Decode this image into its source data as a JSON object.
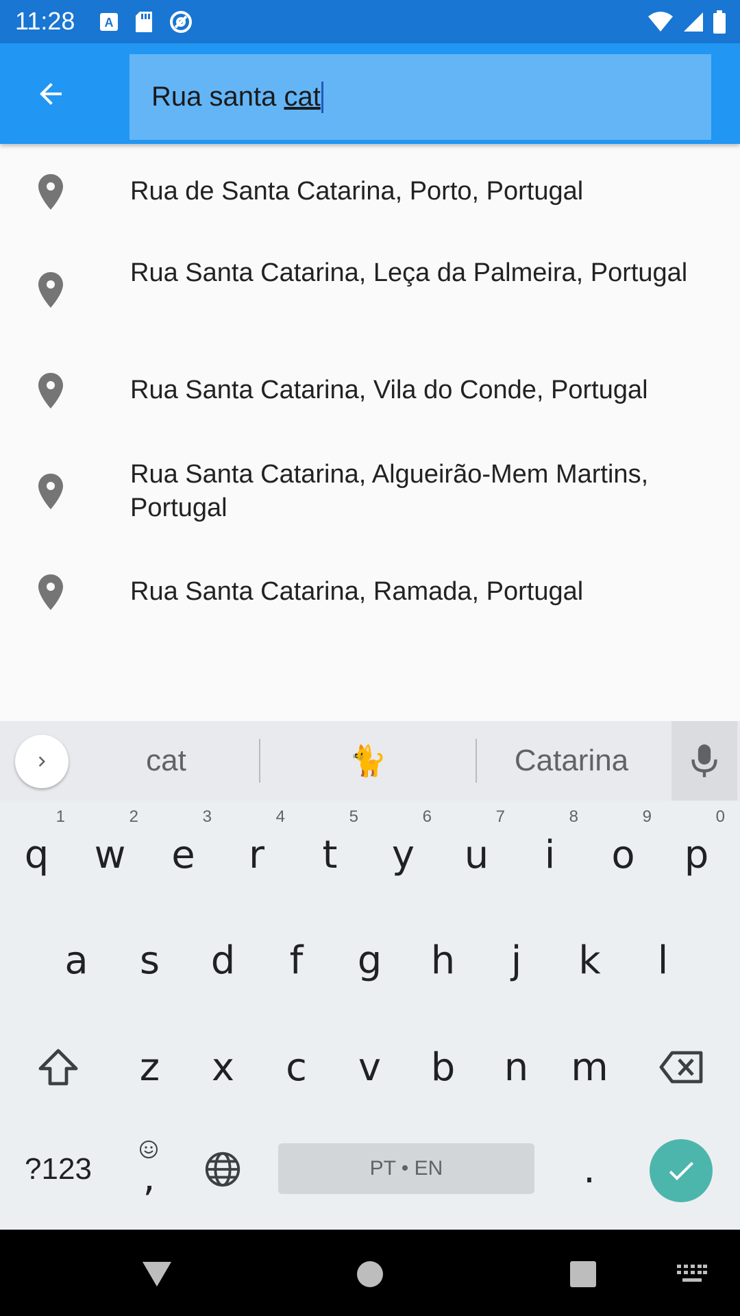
{
  "status_bar": {
    "time": "11:28",
    "left_icons": [
      "text-a-icon",
      "sd-card-icon",
      "at-sync-icon"
    ],
    "right_icons": [
      "wifi-icon",
      "signal-icon",
      "battery-icon"
    ]
  },
  "app_bar": {
    "back_icon": "arrow-back-icon",
    "search": {
      "value_plain": "Rua santa ",
      "value_composing": "cat"
    }
  },
  "results": [
    {
      "label": "Rua de Santa Catarina, Porto, Portugal",
      "icon": "place-pin-icon"
    },
    {
      "label": "Rua Santa Catarina, Leça da Palmeira, Portugal",
      "icon": "place-pin-icon"
    },
    {
      "label": "Rua Santa Catarina, Vila do Conde, Portugal",
      "icon": "place-pin-icon"
    },
    {
      "label": "Rua Santa Catarina, Algueirão-Mem Martins, Portugal",
      "icon": "place-pin-icon"
    },
    {
      "label": "Rua Santa Catarina, Ramada, Portugal",
      "icon": "place-pin-icon"
    }
  ],
  "keyboard": {
    "suggestions": [
      "cat",
      "🐈",
      "Catarina"
    ],
    "row1": [
      {
        "key": "q",
        "hint": "1"
      },
      {
        "key": "w",
        "hint": "2"
      },
      {
        "key": "e",
        "hint": "3"
      },
      {
        "key": "r",
        "hint": "4"
      },
      {
        "key": "t",
        "hint": "5"
      },
      {
        "key": "y",
        "hint": "6"
      },
      {
        "key": "u",
        "hint": "7"
      },
      {
        "key": "i",
        "hint": "8"
      },
      {
        "key": "o",
        "hint": "9"
      },
      {
        "key": "p",
        "hint": "0"
      }
    ],
    "row2": [
      "a",
      "s",
      "d",
      "f",
      "g",
      "h",
      "j",
      "k",
      "l"
    ],
    "row3": [
      "z",
      "x",
      "c",
      "v",
      "b",
      "n",
      "m"
    ],
    "symbols_key": "?123",
    "comma_key": ",",
    "period_key": ".",
    "space_label": "PT • EN"
  },
  "colors": {
    "status_bar": "#1976d2",
    "app_bar": "#2196f3",
    "search_field": "#64b5f6",
    "enter_key": "#4db6ac"
  }
}
